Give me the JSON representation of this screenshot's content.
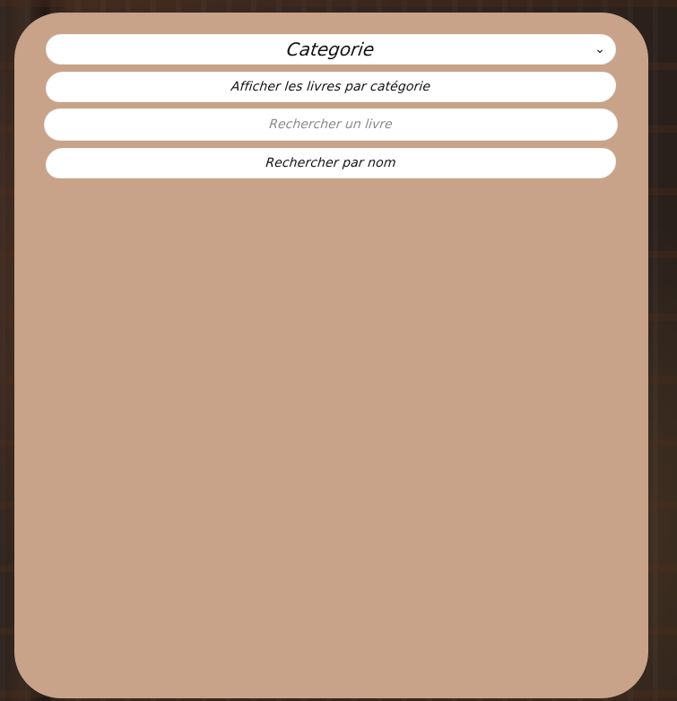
{
  "ui": {
    "category_select": {
      "value": "Categorie",
      "chevron_icon": "chevron-down-icon"
    },
    "buttons": {
      "show_by_category": "Afficher les livres par catégorie",
      "search_by_name": "Rechercher par nom"
    },
    "search": {
      "placeholder": "Rechercher un livre",
      "value": ""
    }
  },
  "colors": {
    "panel_bg": "#c8a389",
    "control_bg": "#ffffff"
  }
}
